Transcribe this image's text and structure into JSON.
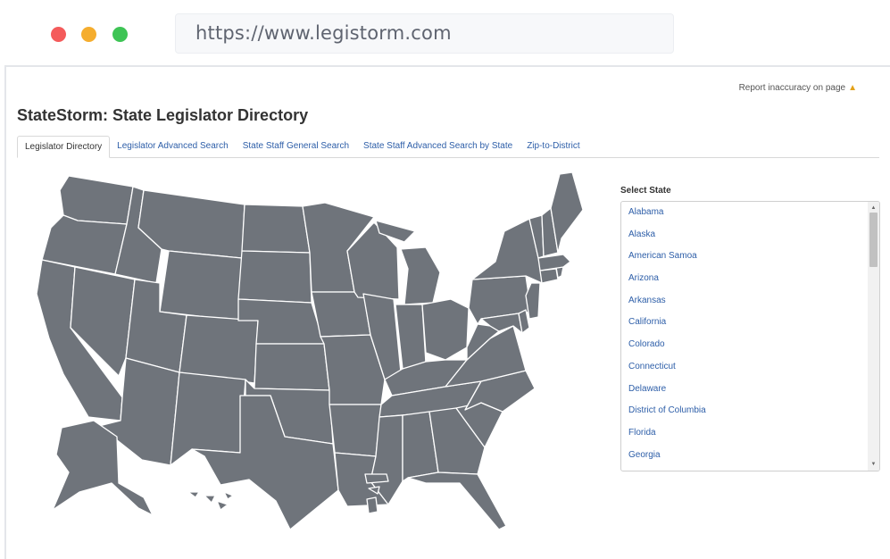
{
  "browser": {
    "url": "https://www.legistorm.com"
  },
  "page": {
    "report_label": "Report inaccuracy on page",
    "title": "StateStorm: State Legislator Directory"
  },
  "tabs": [
    {
      "label": "Legislator Directory",
      "active": true
    },
    {
      "label": "Legislator Advanced Search",
      "active": false
    },
    {
      "label": "State Staff General Search",
      "active": false
    },
    {
      "label": "State Staff Advanced Search by State",
      "active": false
    },
    {
      "label": "Zip-to-District",
      "active": false
    }
  ],
  "select_state": {
    "label": "Select State",
    "options": [
      "Alabama",
      "Alaska",
      "American Samoa",
      "Arizona",
      "Arkansas",
      "California",
      "Colorado",
      "Connecticut",
      "Delaware",
      "District of Columbia",
      "Florida",
      "Georgia"
    ]
  },
  "icons": {
    "report": "warning-triangle-icon",
    "scroll_up": "scroll-up-arrow-icon",
    "scroll_down": "scroll-down-arrow-icon"
  },
  "colors": {
    "map_fill": "#6f747b",
    "map_border": "#ffffff",
    "link": "#2d5ea8",
    "dot_red": "#f45b5b",
    "dot_yellow": "#f5ad2e",
    "dot_green": "#3ec455"
  }
}
